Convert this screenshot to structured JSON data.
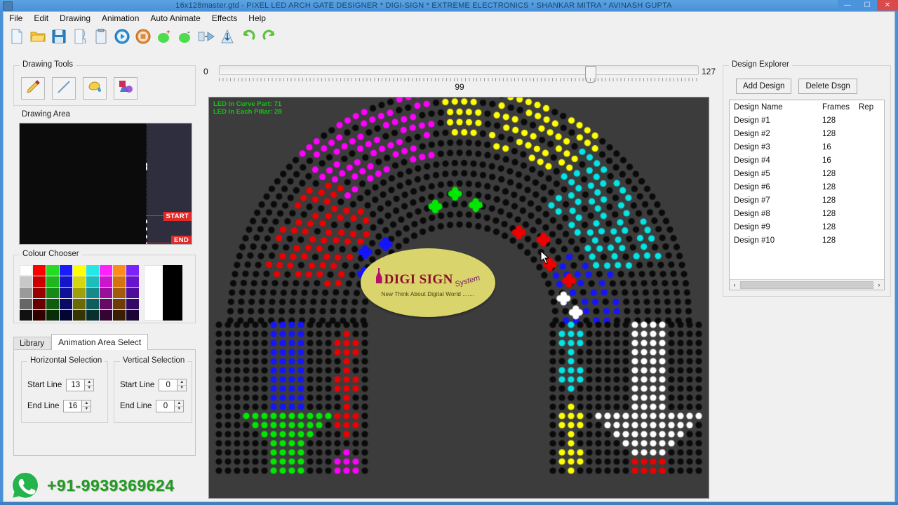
{
  "window": {
    "title": "16x128master.gtd  -  PIXEL LED ARCH GATE DESIGNER * DIGI-SIGN * EXTREME ELECTRONICS * SHANKAR MITRA * AVINASH GUPTA",
    "minimize": "—",
    "maximize": "☐",
    "close": "✕"
  },
  "menu": {
    "items": [
      {
        "label": "File"
      },
      {
        "label": "Edit"
      },
      {
        "label": "Drawing"
      },
      {
        "label": "Animation"
      },
      {
        "label": "Auto Animate"
      },
      {
        "label": "Effects"
      },
      {
        "label": "Help"
      }
    ]
  },
  "toolbar": {
    "buttons": [
      {
        "name": "new-file-icon",
        "title": "New"
      },
      {
        "name": "open-folder-icon",
        "title": "Open"
      },
      {
        "name": "save-disk-icon",
        "title": "Save"
      },
      {
        "name": "page-curl-icon",
        "title": "Save As"
      },
      {
        "name": "clipboard-icon",
        "title": "Paste"
      },
      {
        "name": "play-icon",
        "title": "Play"
      },
      {
        "name": "stop-icon",
        "title": "Stop"
      },
      {
        "name": "add-frame-icon",
        "title": "Add Frame"
      },
      {
        "name": "remove-frame-icon",
        "title": "Remove Frame"
      },
      {
        "name": "mirror-icon",
        "title": "Mirror"
      },
      {
        "name": "flip-icon",
        "title": "Flip"
      },
      {
        "name": "undo-icon",
        "title": "Undo"
      },
      {
        "name": "redo-icon",
        "title": "Redo"
      }
    ]
  },
  "drawing_tools": {
    "label": "Drawing Tools",
    "tools": [
      {
        "name": "pencil-tool",
        "icon": "pencil-icon"
      },
      {
        "name": "line-tool",
        "icon": "line-icon"
      },
      {
        "name": "fill-tool",
        "icon": "paint-bucket-icon"
      },
      {
        "name": "shapes-tool",
        "icon": "shapes-icon"
      }
    ]
  },
  "drawing_area": {
    "label": "Drawing Area",
    "start_tag": "START",
    "end_tag": "END"
  },
  "colour_chooser": {
    "label": "Colour Chooser",
    "palette_rows": [
      [
        "#ffffff",
        "#ff0000",
        "#22dd22",
        "#1b1bff",
        "#ffff00",
        "#22e8e8",
        "#ff22ff",
        "#ff8c1a",
        "#7b22ff"
      ],
      [
        "#c8c8c8",
        "#cc0000",
        "#1eb81e",
        "#1515cc",
        "#d6d60d",
        "#1ebcbc",
        "#cc15cc",
        "#d4740f",
        "#6615cc"
      ],
      [
        "#9a9a9a",
        "#990000",
        "#168a16",
        "#101099",
        "#a0a009",
        "#168a8a",
        "#990f99",
        "#a35a0c",
        "#4d0f99"
      ],
      [
        "#666666",
        "#660000",
        "#0f5c0f",
        "#0a0a66",
        "#6b6b06",
        "#0f5c5c",
        "#660a66",
        "#6e3c08",
        "#330a66"
      ],
      [
        "#111111",
        "#330000",
        "#082e08",
        "#050533",
        "#353503",
        "#082e2e",
        "#330533",
        "#371e04",
        "#1a0533"
      ]
    ],
    "big_white": "#ffffff",
    "big_black": "#000000"
  },
  "tabs": {
    "items": [
      {
        "label": "Library",
        "active": false
      },
      {
        "label": "Animation Area Select",
        "active": true
      }
    ]
  },
  "animation_area": {
    "horizontal": {
      "label": "Horizontal Selection",
      "start_line_label": "Start Line",
      "start_line_value": "13",
      "end_line_label": "End Line",
      "end_line_value": "16"
    },
    "vertical": {
      "label": "Vertical Selection",
      "start_line_label": "Start Line",
      "start_line_value": "0",
      "end_line_label": "End Line",
      "end_line_value": "0"
    }
  },
  "frame_slider": {
    "min": "0",
    "max": "127",
    "value": "99",
    "thumb_percent": 77.8
  },
  "led_canvas": {
    "info_line1": "LED In Curve Part: 71",
    "info_line2": "LED In Each Pillar: 28",
    "info_color": "#13c413",
    "background": "#3c3c3c",
    "off_led_color": "#0a0a0a",
    "logo": {
      "brand": "DIGI SIGN",
      "system": "System",
      "tagline": "New Think About Digital World ......."
    },
    "colors": {
      "yellow": "#ffff00",
      "magenta": "#ff00ff",
      "cyan": "#00e5e5",
      "blue": "#1414ff",
      "green": "#00e800",
      "red": "#ee0000",
      "white": "#ffffff"
    }
  },
  "design_explorer": {
    "label": "Design Explorer",
    "add_button": "Add Design",
    "delete_button": "Delete Dsgn",
    "columns": [
      "Design Name",
      "Frames",
      "Rep"
    ],
    "rows": [
      {
        "name": "Design #1",
        "frames": "128",
        "rep": ""
      },
      {
        "name": "Design #2",
        "frames": "128",
        "rep": ""
      },
      {
        "name": "Design #3",
        "frames": "16",
        "rep": ""
      },
      {
        "name": "Design #4",
        "frames": "16",
        "rep": ""
      },
      {
        "name": "Design #5",
        "frames": "128",
        "rep": ""
      },
      {
        "name": "Design #6",
        "frames": "128",
        "rep": ""
      },
      {
        "name": "Design #7",
        "frames": "128",
        "rep": ""
      },
      {
        "name": "Design #8",
        "frames": "128",
        "rep": ""
      },
      {
        "name": "Design #9",
        "frames": "128",
        "rep": ""
      },
      {
        "name": "Design #10",
        "frames": "128",
        "rep": ""
      }
    ],
    "scroll_left": "‹",
    "scroll_right": "›"
  },
  "whatsapp_banner": {
    "icon": "whatsapp-icon",
    "phone": "+91-9939369624",
    "color": "#1f9c1f"
  }
}
